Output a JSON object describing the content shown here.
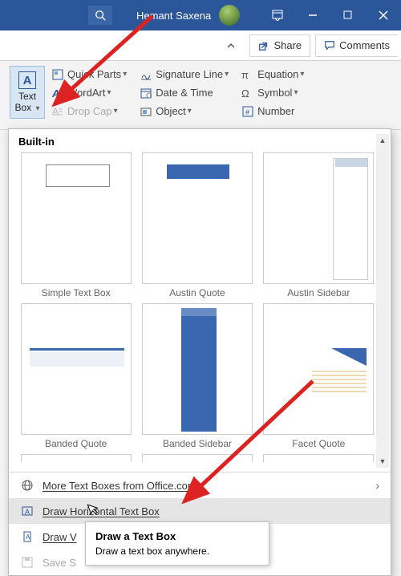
{
  "titlebar": {
    "user_name": "Hemant Saxena"
  },
  "actions": {
    "share": "Share",
    "comments": "Comments"
  },
  "ribbon": {
    "textbox": {
      "label1": "Text",
      "label2": "Box"
    },
    "quick_parts": "Quick Parts",
    "wordart": "WordArt",
    "drop_cap": "Drop Cap",
    "signature": "Signature Line",
    "datetime": "Date & Time",
    "object": "Object",
    "equation": "Equation",
    "symbol": "Symbol",
    "number": "Number"
  },
  "gallery": {
    "section": "Built-in",
    "items": [
      {
        "label": "Simple Text Box"
      },
      {
        "label": "Austin Quote"
      },
      {
        "label": "Austin Sidebar"
      },
      {
        "label": "Banded Quote"
      },
      {
        "label": "Banded Sidebar"
      },
      {
        "label": "Facet Quote"
      }
    ],
    "more_from_office": "More Text Boxes from Office.com",
    "draw_h": "Draw Horizontal Text Box",
    "draw_v": "Draw V",
    "save_sel": "Save S"
  },
  "tooltip": {
    "title": "Draw a Text Box",
    "body": "Draw a text box anywhere."
  }
}
